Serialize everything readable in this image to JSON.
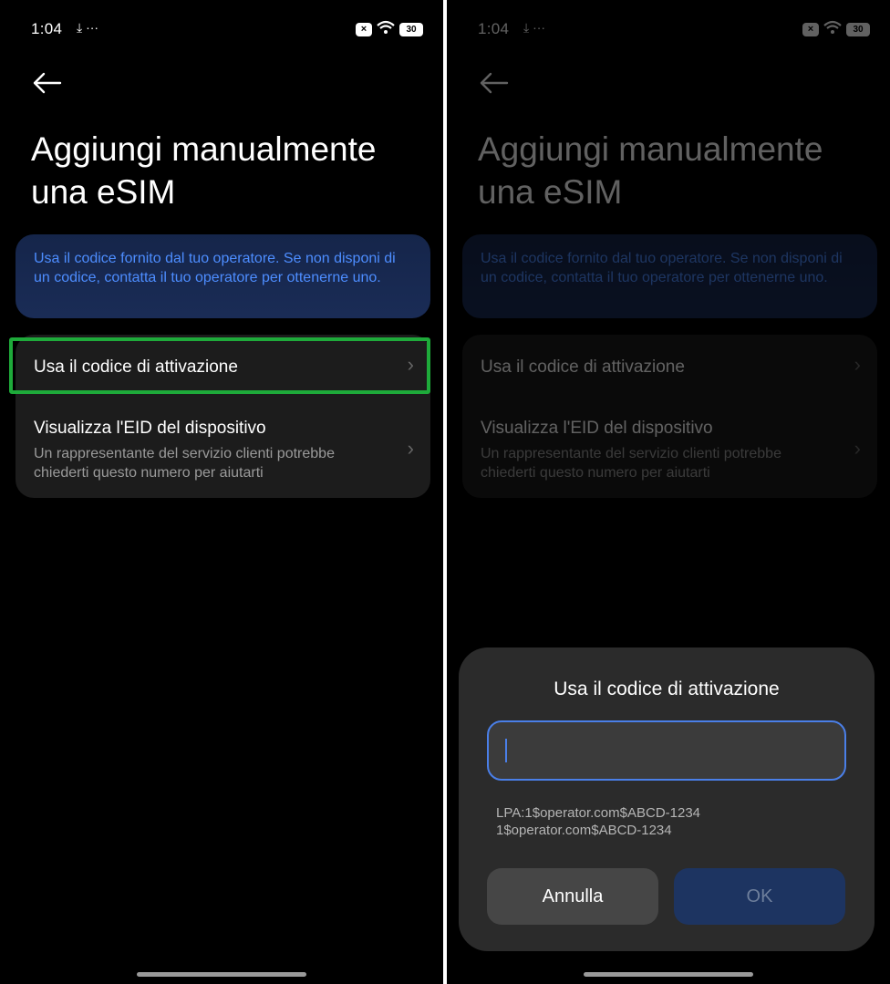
{
  "status": {
    "time": "1:04",
    "extra_icons": "⤓ ···",
    "battery": "30",
    "x_badge": "×"
  },
  "page": {
    "title_line1": "Aggiungi manualmente",
    "title_line2": "una eSIM",
    "info_text": "Usa il codice fornito dal tuo operatore. Se non disponi di un codice, contatta il tuo operatore per ottenerne uno.",
    "items": [
      {
        "label": "Usa il codice di attivazione"
      },
      {
        "label": "Visualizza l'EID del dispositivo",
        "subtitle": "Un rappresentante del servizio clienti potrebbe chiederti questo numero per aiutarti"
      }
    ]
  },
  "dialog": {
    "title": "Usa il codice di attivazione",
    "input_value": "",
    "hint_line1": "LPA:1$operator.com$ABCD-1234",
    "hint_line2": "1$operator.com$ABCD-1234",
    "cancel_label": "Annulla",
    "ok_label": "OK"
  },
  "colors": {
    "accent_blue": "#4a7fe8",
    "info_text": "#4d8dff",
    "highlight_green": "#1eaa3a"
  }
}
